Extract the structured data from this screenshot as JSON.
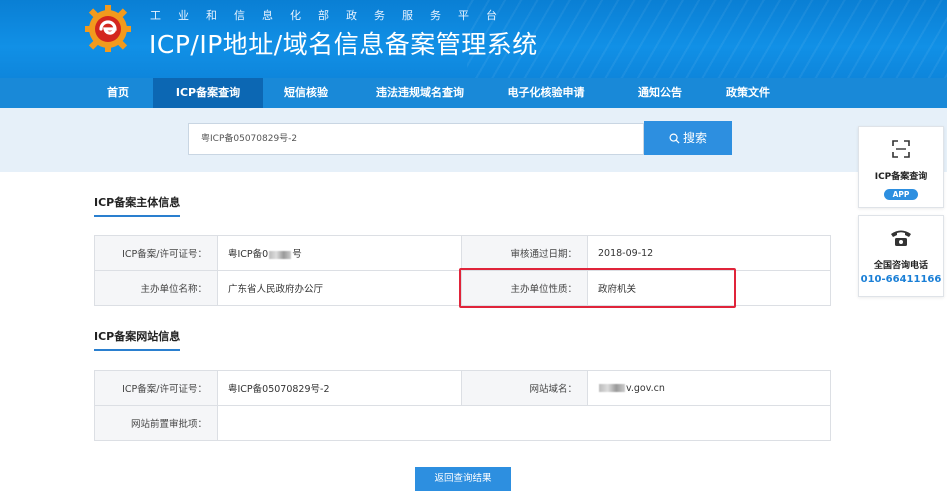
{
  "header": {
    "subtitle": "工业和信息化部政务服务平台",
    "title": "ICP/IP地址/域名信息备案管理系统"
  },
  "nav": {
    "items": [
      {
        "label": "首页"
      },
      {
        "label": "ICP备案查询"
      },
      {
        "label": "短信核验"
      },
      {
        "label": "违法违规域名查询"
      },
      {
        "label": "电子化核验申请"
      },
      {
        "label": "通知公告"
      },
      {
        "label": "政策文件"
      }
    ],
    "active_index": 1
  },
  "search": {
    "value": "粤ICP备05070829号-2",
    "button_label": "搜索"
  },
  "subject_section": {
    "title": "ICP备案主体信息",
    "license_label": "ICP备案/许可证号：",
    "license_value_prefix": "粤ICP备0",
    "license_value_suffix": "号",
    "approval_date_label": "审核通过日期：",
    "approval_date_value": "2018-09-12",
    "sponsor_name_label": "主办单位名称：",
    "sponsor_name_value": "广东省人民政府办公厅",
    "sponsor_type_label": "主办单位性质：",
    "sponsor_type_value": "政府机关"
  },
  "website_section": {
    "title": "ICP备案网站信息",
    "license_label": "ICP备案/许可证号：",
    "license_value": "粤ICP备05070829号-2",
    "domain_label": "网站域名：",
    "domain_value_suffix": "v.gov.cn",
    "preapproval_label": "网站前置审批项：",
    "preapproval_value": ""
  },
  "back_button_label": "返回查询结果",
  "side": {
    "app_query_label": "ICP备案查询",
    "app_pill": "APP",
    "hotline_label": "全国咨询电话",
    "hotline_number": "010-66411166"
  },
  "colors": {
    "header_blue": "#0a7fd4",
    "nav_active": "#0c67b3",
    "button_blue": "#2d8fe0",
    "highlight_red": "#e0243a"
  },
  "icons": [
    "logo-icon",
    "search-icon",
    "scan-icon",
    "phone-icon"
  ]
}
